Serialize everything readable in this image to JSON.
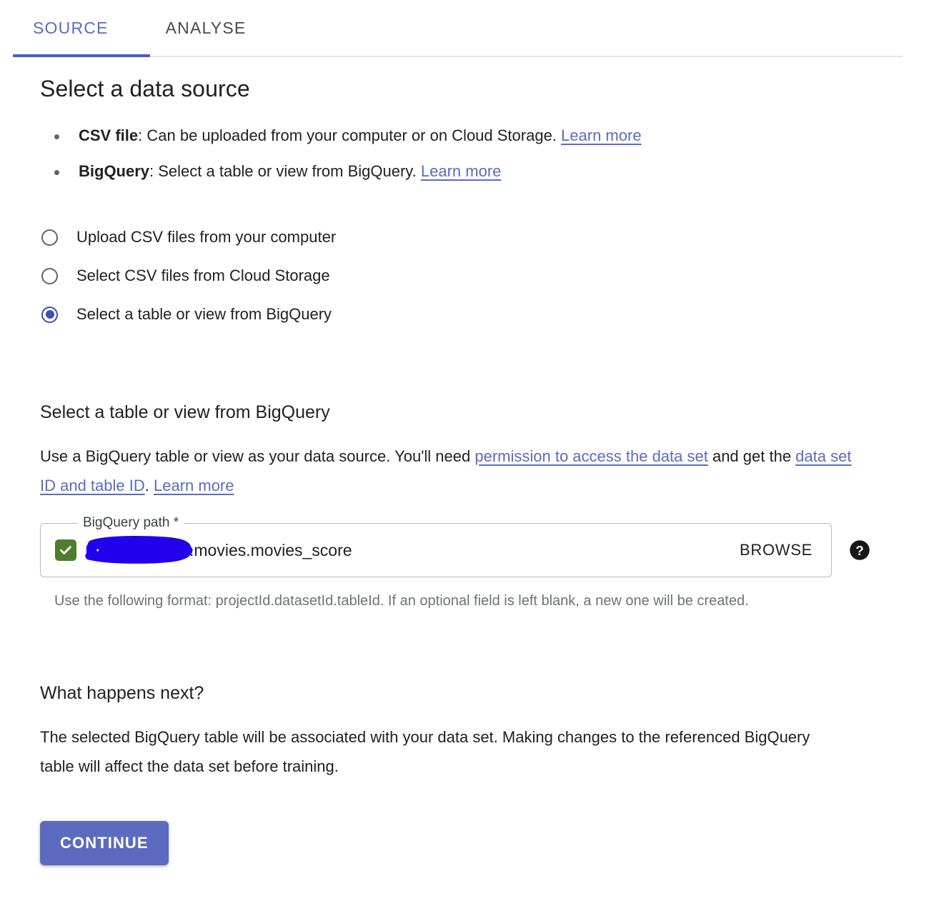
{
  "tabs": [
    {
      "label": "SOURCE",
      "active": true
    },
    {
      "label": "ANALYSE",
      "active": false
    }
  ],
  "page_title": "Select a data source",
  "source_bullets": [
    {
      "term": "CSV file",
      "text": ": Can be uploaded from your computer or on Cloud Storage. ",
      "link": "Learn more"
    },
    {
      "term": "BigQuery",
      "text": ": Select a table or view from BigQuery. ",
      "link": "Learn more"
    }
  ],
  "radio_options": [
    {
      "label": "Upload CSV files from your computer",
      "selected": false
    },
    {
      "label": "Select CSV files from Cloud Storage",
      "selected": false
    },
    {
      "label": "Select a table or view from BigQuery",
      "selected": true
    }
  ],
  "bigquery_section": {
    "title": "Select a table or view from BigQuery",
    "desc_part1": "Use a BigQuery table or view as your data source. You'll need ",
    "link1": "permission to access the data set",
    "desc_part2": " and get the ",
    "link2": "data set ID and table ID",
    "desc_part3": ". ",
    "link3": "Learn more",
    "field": {
      "label": "BigQuery path *",
      "value": ".movies.movies_score",
      "placeholder": "projectId.datasetId.tableId",
      "status": "valid",
      "browse_label": "BROWSE",
      "help_icon": "help-circle-icon",
      "redaction_color": "#2200ee",
      "check_color": "#4e7d2e"
    },
    "hint": "Use the following format: projectId.datasetId.tableId. If an optional field is left blank, a new one will be created."
  },
  "next_section": {
    "title": "What happens next?",
    "desc": "The selected BigQuery table will be associated with your data set. Making changes to the referenced BigQuery table will affect the data set before training."
  },
  "continue_label": "CONTINUE",
  "colors": {
    "accent": "#5c6bc0",
    "tab_active": "#5c6bc0",
    "tab_indicator": "#4a5ac4",
    "link": "#5c6bc0",
    "text": "#202124",
    "hint": "#6e7276"
  }
}
